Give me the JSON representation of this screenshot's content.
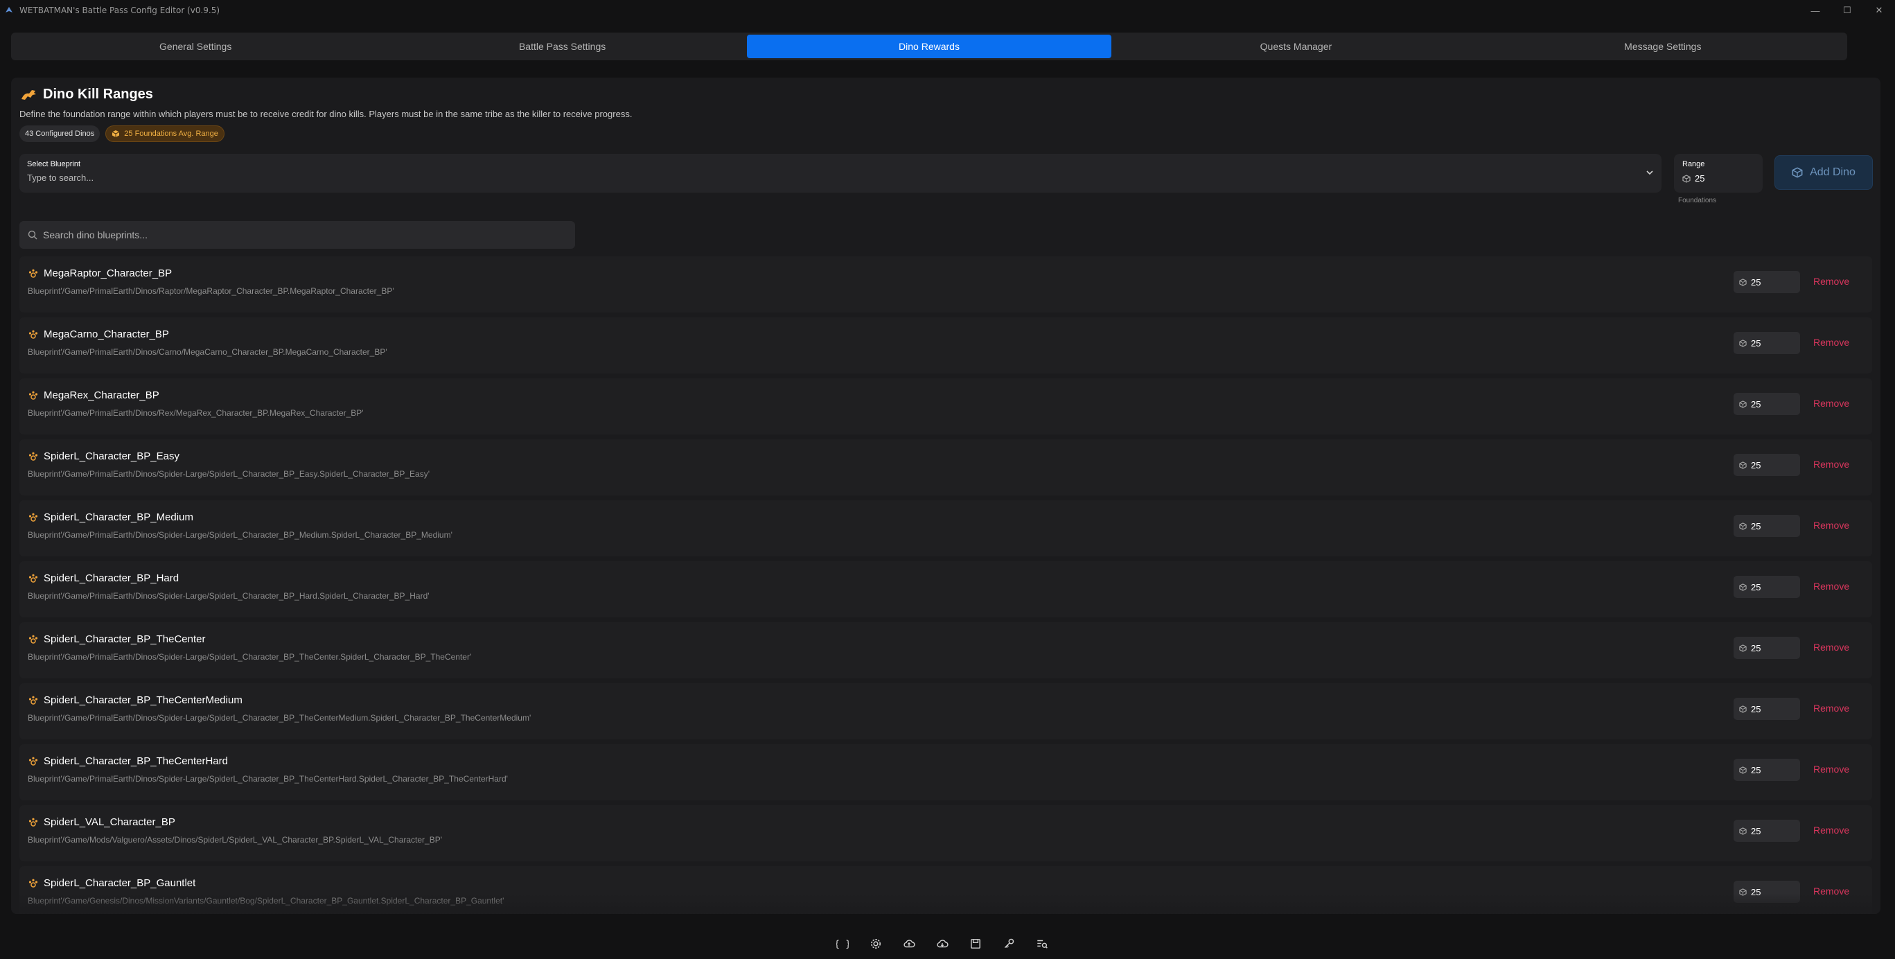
{
  "window": {
    "title": "WETBATMAN's Battle Pass Config Editor (v0.9.5)",
    "controls": [
      "minimize-icon",
      "maximize-icon",
      "close-icon"
    ]
  },
  "tabs": [
    {
      "label": "General Settings",
      "active": false
    },
    {
      "label": "Battle Pass Settings",
      "active": false
    },
    {
      "label": "Dino Rewards",
      "active": true
    },
    {
      "label": "Quests Manager",
      "active": false
    },
    {
      "label": "Message Settings",
      "active": false
    }
  ],
  "section": {
    "title": "Dino Kill Ranges",
    "description": "Define the foundation range within which players must be to receive credit for dino kills. Players must be in the same tribe as the killer to receive progress.",
    "badges": {
      "configured": "43 Configured Dinos",
      "avg_range": "25 Foundations Avg. Range"
    }
  },
  "form": {
    "select_label": "Select Blueprint",
    "select_placeholder": "Type to search...",
    "range_label": "Range",
    "range_value": "25",
    "range_unit": "Foundations",
    "add_button": "Add Dino"
  },
  "search": {
    "placeholder": "Search dino blueprints..."
  },
  "remove_label": "Remove",
  "dinos": [
    {
      "name": "MegaRaptor_Character_BP",
      "path": "Blueprint'/Game/PrimalEarth/Dinos/Raptor/MegaRaptor_Character_BP.MegaRaptor_Character_BP'",
      "range": "25"
    },
    {
      "name": "MegaCarno_Character_BP",
      "path": "Blueprint'/Game/PrimalEarth/Dinos/Carno/MegaCarno_Character_BP.MegaCarno_Character_BP'",
      "range": "25"
    },
    {
      "name": "MegaRex_Character_BP",
      "path": "Blueprint'/Game/PrimalEarth/Dinos/Rex/MegaRex_Character_BP.MegaRex_Character_BP'",
      "range": "25"
    },
    {
      "name": "SpiderL_Character_BP_Easy",
      "path": "Blueprint'/Game/PrimalEarth/Dinos/Spider-Large/SpiderL_Character_BP_Easy.SpiderL_Character_BP_Easy'",
      "range": "25"
    },
    {
      "name": "SpiderL_Character_BP_Medium",
      "path": "Blueprint'/Game/PrimalEarth/Dinos/Spider-Large/SpiderL_Character_BP_Medium.SpiderL_Character_BP_Medium'",
      "range": "25"
    },
    {
      "name": "SpiderL_Character_BP_Hard",
      "path": "Blueprint'/Game/PrimalEarth/Dinos/Spider-Large/SpiderL_Character_BP_Hard.SpiderL_Character_BP_Hard'",
      "range": "25"
    },
    {
      "name": "SpiderL_Character_BP_TheCenter",
      "path": "Blueprint'/Game/PrimalEarth/Dinos/Spider-Large/SpiderL_Character_BP_TheCenter.SpiderL_Character_BP_TheCenter'",
      "range": "25"
    },
    {
      "name": "SpiderL_Character_BP_TheCenterMedium",
      "path": "Blueprint'/Game/PrimalEarth/Dinos/Spider-Large/SpiderL_Character_BP_TheCenterMedium.SpiderL_Character_BP_TheCenterMedium'",
      "range": "25"
    },
    {
      "name": "SpiderL_Character_BP_TheCenterHard",
      "path": "Blueprint'/Game/PrimalEarth/Dinos/Spider-Large/SpiderL_Character_BP_TheCenterHard.SpiderL_Character_BP_TheCenterHard'",
      "range": "25"
    },
    {
      "name": "SpiderL_VAL_Character_BP",
      "path": "Blueprint'/Game/Mods/Valguero/Assets/Dinos/SpiderL/SpiderL_VAL_Character_BP.SpiderL_VAL_Character_BP'",
      "range": "25"
    },
    {
      "name": "SpiderL_Character_BP_Gauntlet",
      "path": "Blueprint'/Game/Genesis/Dinos/MissionVariants/Gauntlet/Bog/SpiderL_Character_BP_Gauntlet.SpiderL_Character_BP_Gauntlet'",
      "range": "25"
    }
  ],
  "toolbar": [
    "code-braces-icon",
    "settings-gear-icon",
    "cloud-upload-icon",
    "cloud-download-icon",
    "save-icon",
    "key-icon",
    "search-list-icon"
  ],
  "colors": {
    "accent": "#0a6ff0",
    "remove": "#d9365d",
    "badge_orange": "#f1b043",
    "dino_icon": "#f0a33a"
  }
}
